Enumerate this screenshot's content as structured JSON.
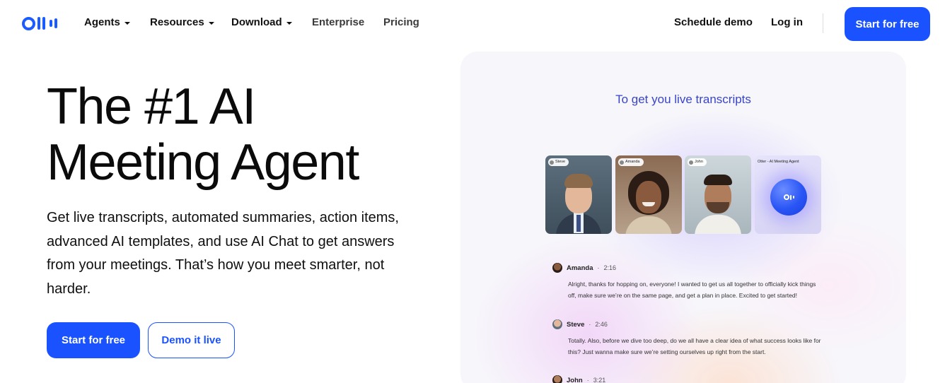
{
  "nav": {
    "items": [
      {
        "label": "Agents",
        "dropdown": true
      },
      {
        "label": "Resources",
        "dropdown": true
      },
      {
        "label": "Download",
        "dropdown": true
      },
      {
        "label": "Enterprise",
        "dropdown": false
      },
      {
        "label": "Pricing",
        "dropdown": false
      }
    ],
    "schedule_demo": "Schedule demo",
    "login": "Log in",
    "cta": "Start for free"
  },
  "hero": {
    "headline_line1": "The #1 AI",
    "headline_line2": "Meeting Agent",
    "subcopy": "Get live transcripts, automated summaries, action items, advanced AI templates, and use AI Chat to get answers from your meetings. That’s how you meet smarter, not harder.",
    "primary_button": "Start for free",
    "secondary_button": "Demo it live"
  },
  "demo": {
    "title": "To get you live transcripts",
    "participants": [
      {
        "tag": "Steve"
      },
      {
        "tag": "Amanda"
      },
      {
        "tag": "John"
      },
      {
        "tag": "Otter - AI Meeting Agent"
      }
    ],
    "messages": [
      {
        "name": "Amanda",
        "time": "2:16",
        "text": "Alright, thanks for hopping on, everyone! I wanted to get us all together to officially kick things off, make sure we’re on the same page, and get a plan in place. Excited to get started!"
      },
      {
        "name": "Steve",
        "time": "2:46",
        "text": "Totally. Also, before we dive too deep, do we all have a clear idea of what success looks like for this? Just wanna make sure we’re setting ourselves up right from the start."
      },
      {
        "name": "John",
        "time": "3:21",
        "text": ""
      }
    ]
  },
  "colors": {
    "brand_blue": "#1a52ff",
    "panel_title": "#3845c7"
  }
}
